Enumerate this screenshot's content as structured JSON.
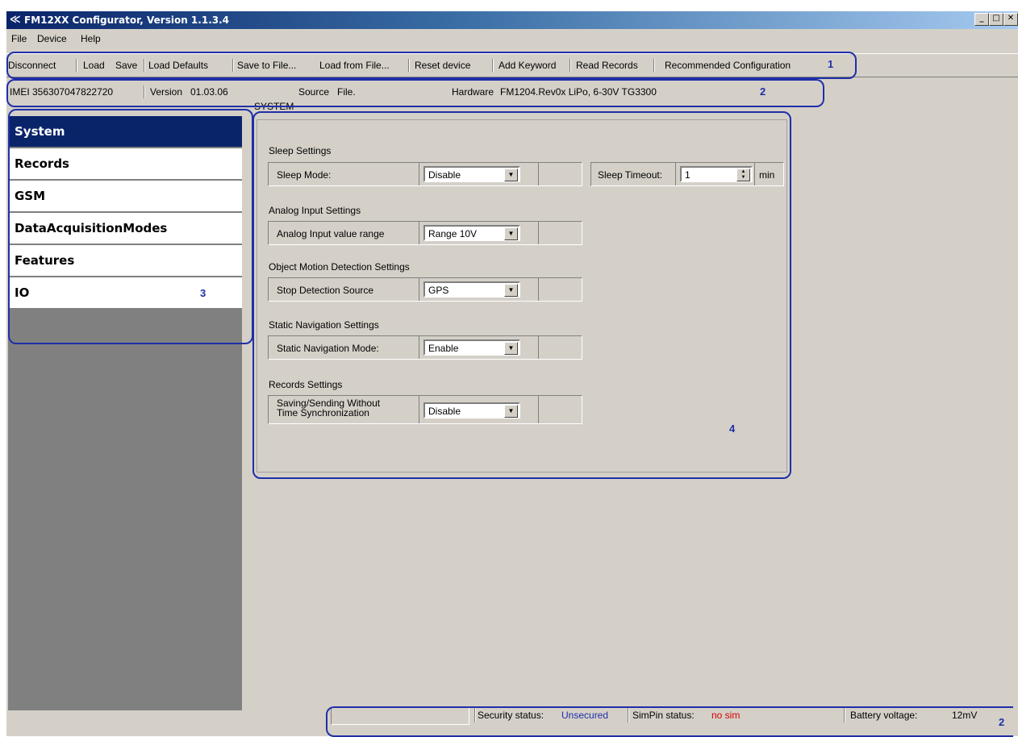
{
  "window": {
    "title": "FM12XX Configurator, Version 1.1.3.4",
    "app_icon": "satellite-icon",
    "controls": {
      "minimize": "_",
      "maximize": "□",
      "close": "✕"
    }
  },
  "menubar": {
    "items": [
      "File",
      "Device",
      "Help"
    ]
  },
  "toolbar": {
    "items": [
      "Disconnect",
      "Load",
      "Save",
      "Load Defaults",
      "Save to File...",
      "Load from File...",
      "Reset device",
      "Add Keyword",
      "Read Records",
      "Recommended Configuration"
    ]
  },
  "infobar": {
    "imei_label": "IMEI",
    "imei_value": "356307047822720",
    "version_label": "Version",
    "version_value": "01.03.06",
    "source_label": "Source",
    "source_value": "File.",
    "hardware_label": "Hardware",
    "hardware_value": "FM1204.Rev0x LiPo, 6-30V TG3300"
  },
  "annotations": {
    "n1": "1",
    "n2": "2",
    "n3": "3",
    "n4": "4",
    "n2b": "2"
  },
  "sidebar": {
    "items": [
      {
        "label": "System",
        "active": true
      },
      {
        "label": "Records",
        "active": false
      },
      {
        "label": "GSM",
        "active": false
      },
      {
        "label": "DataAcquisitionModes",
        "active": false
      },
      {
        "label": "Features",
        "active": false
      },
      {
        "label": "IO",
        "active": false
      }
    ]
  },
  "system": {
    "legend": "SYSTEM",
    "sleep": {
      "section": "Sleep Settings",
      "mode_label": "Sleep Mode:",
      "mode_value": "Disable",
      "timeout_label": "Sleep Timeout:",
      "timeout_value": "1",
      "timeout_unit": "min"
    },
    "analog": {
      "section": "Analog Input Settings",
      "label": "Analog Input value range",
      "value": "Range 10V"
    },
    "motion": {
      "section": "Object Motion Detection Settings",
      "label": "Stop Detection Source",
      "value": "GPS"
    },
    "static_nav": {
      "section": "Static Navigation Settings",
      "label": "Static Navigation Mode:",
      "value": "Enable"
    },
    "records": {
      "section": "Records Settings",
      "label_line1": "Saving/Sending Without",
      "label_line2": "Time Synchronization",
      "value": "Disable"
    }
  },
  "statusbar": {
    "security_label": "Security status:",
    "security_value": "Unsecured",
    "simpin_label": "SimPin status:",
    "simpin_value": "no sim",
    "battery_label": "Battery voltage:",
    "battery_value": "12mV"
  },
  "colors": {
    "annotation": "#1f2fa8",
    "active_nav": "#0a246a",
    "security_value": "#1f2fa8",
    "simpin_value": "#d40000"
  }
}
